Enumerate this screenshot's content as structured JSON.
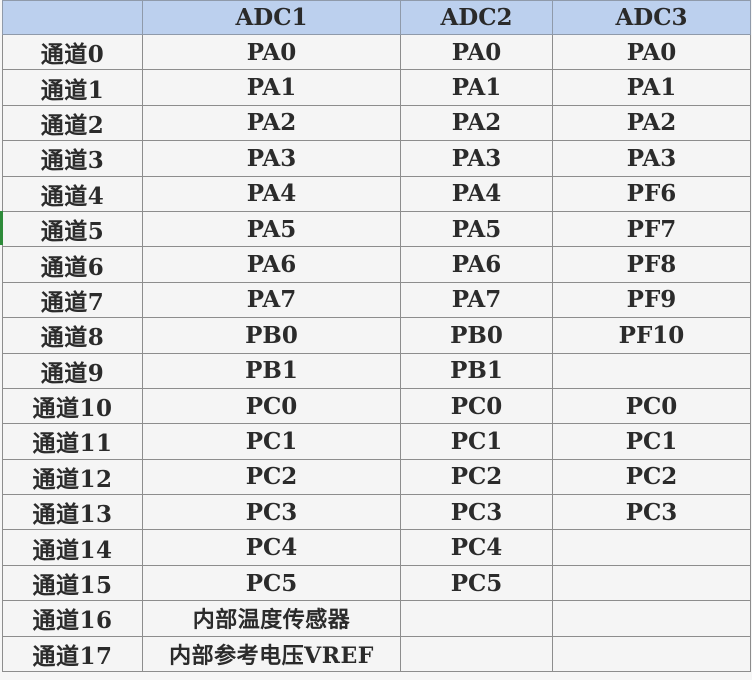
{
  "table": {
    "headers": [
      "",
      "ADC1",
      "ADC2",
      "ADC3"
    ],
    "rows": [
      [
        "通道0",
        "PA0",
        "PA0",
        "PA0"
      ],
      [
        "通道1",
        "PA1",
        "PA1",
        "PA1"
      ],
      [
        "通道2",
        "PA2",
        "PA2",
        "PA2"
      ],
      [
        "通道3",
        "PA3",
        "PA3",
        "PA3"
      ],
      [
        "通道4",
        "PA4",
        "PA4",
        "PF6"
      ],
      [
        "通道5",
        "PA5",
        "PA5",
        "PF7"
      ],
      [
        "通道6",
        "PA6",
        "PA6",
        "PF8"
      ],
      [
        "通道7",
        "PA7",
        "PA7",
        "PF9"
      ],
      [
        "通道8",
        "PB0",
        "PB0",
        "PF10"
      ],
      [
        "通道9",
        "PB1",
        "PB1",
        ""
      ],
      [
        "通道10",
        "PC0",
        "PC0",
        "PC0"
      ],
      [
        "通道11",
        "PC1",
        "PC1",
        "PC1"
      ],
      [
        "通道12",
        "PC2",
        "PC2",
        "PC2"
      ],
      [
        "通道13",
        "PC3",
        "PC3",
        "PC3"
      ],
      [
        "通道14",
        "PC4",
        "PC4",
        ""
      ],
      [
        "通道15",
        "PC5",
        "PC5",
        ""
      ],
      [
        "通道16",
        "内部温度传感器",
        "",
        ""
      ],
      [
        "通道17",
        "内部参考电压VREF",
        "",
        ""
      ]
    ]
  },
  "colors": {
    "header_background": "#bcd0ee",
    "cell_background": "#f5f5f5",
    "grid_line": "#8d8d8d",
    "selection_marker": "#2e8b3a"
  }
}
